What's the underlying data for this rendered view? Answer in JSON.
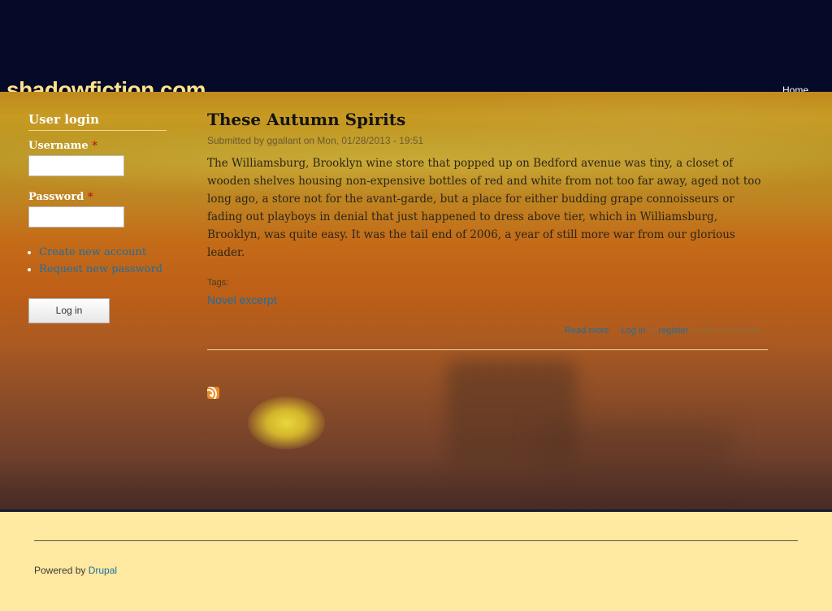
{
  "header": {
    "site_name": "shadowfiction.com",
    "nav": {
      "home": "Home"
    }
  },
  "sidebar": {
    "block_title": "User login",
    "username_label": "Username",
    "password_label": "Password",
    "required_marker": "*",
    "links": [
      {
        "label": "Create new account"
      },
      {
        "label": "Request new password"
      }
    ],
    "login_button": "Log in"
  },
  "node": {
    "title": "These Autumn Spirits",
    "submitted": "Submitted by ggallant on Mon, 01/28/2013 - 19:51",
    "body": "The Williamsburg, Brooklyn wine store that popped up on Bedford avenue was tiny, a closet of wooden shelves housing non-expensive bottles of red and white from not too far away, aged not too long ago, a store not for the avant-garde, but a place for either budding grape connoisseurs or fading out playboys in denial that just happened to dress above tier, which in Williamsburg, Brooklyn, was quite easy. It was the tail end of 2006, a year of still more war from our glorious leader.",
    "tags_label": "Tags:",
    "tag": "Novel excerpt",
    "read_more": "Read more",
    "login_link": "Log in",
    "or_text": "or",
    "register_link": "register",
    "post_comments_text": "to post comments"
  },
  "footer": {
    "powered_by": "Powered by",
    "drupal_link": "Drupal"
  },
  "colors": {
    "header_bg": "#050a28",
    "link": "#1b6fa4",
    "footer_bg": "#ffe89f",
    "site_name": "#ffe38a"
  },
  "icons": {
    "feed": "rss-feed-icon"
  }
}
